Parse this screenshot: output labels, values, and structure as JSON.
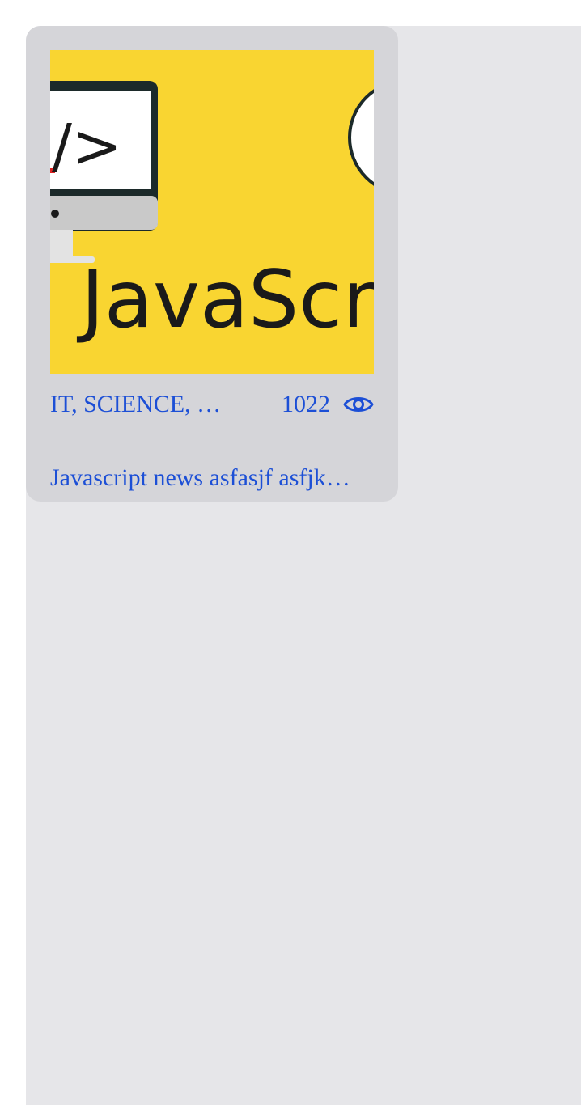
{
  "news_card": {
    "thumbnail": {
      "logo_text": "JavaScri",
      "code_glyph": "/>",
      "icon": "monitor-code-icon",
      "background_color": "#f9d531"
    },
    "categories": "IT, SCIENCE, …",
    "views": "1022",
    "views_icon": "eye-icon",
    "title": "Javascript news asfasjf asfjk…"
  },
  "colors": {
    "accent": "#1c4fd6",
    "card_background": "#d5d5d9",
    "page_background": "#e6e6e9"
  }
}
